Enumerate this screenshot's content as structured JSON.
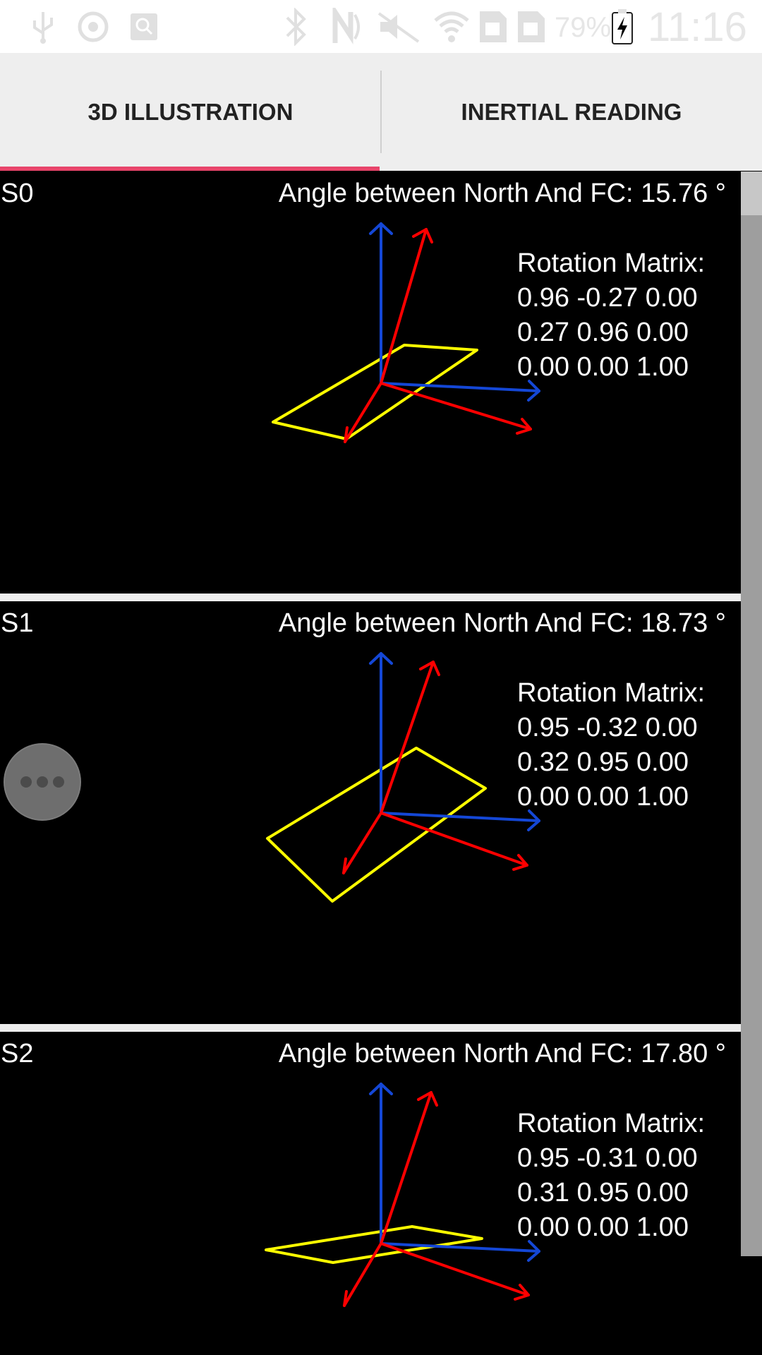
{
  "status_bar": {
    "icons": [
      "usb-icon",
      "sync-icon",
      "screenshot-icon",
      "bluetooth-icon",
      "nfc-icon",
      "mute-icon",
      "wifi-icon",
      "sim1-icon",
      "sim2-icon",
      "battery-charging-icon"
    ],
    "battery": "79%",
    "clock": "11:16"
  },
  "tabs": [
    {
      "label": "3D ILLUSTRATION",
      "selected": true
    },
    {
      "label": "INERTIAL READING",
      "selected": false
    }
  ],
  "colors": {
    "tab_indicator": "#e8456b",
    "z_axis": "#1447d6",
    "device_axes": "#ff0000",
    "device_plane": "#ffff00"
  },
  "sensors": [
    {
      "id": "S0",
      "angle_text": "Angle between North And FC: 15.76 °",
      "matrix_title": "Rotation Matrix:",
      "matrix_rows": [
        "0.96 -0.27 0.00",
        "0.27 0.96 0.00",
        "0.00 0.00 1.00"
      ]
    },
    {
      "id": "S1",
      "angle_text": "Angle between North And FC: 18.73 °",
      "matrix_title": "Rotation Matrix:",
      "matrix_rows": [
        "0.95 -0.32 0.00",
        "0.32 0.95 0.00",
        "0.00 0.00 1.00"
      ]
    },
    {
      "id": "S2",
      "angle_text": "Angle between North And FC: 17.80 °",
      "matrix_title": "Rotation Matrix:",
      "matrix_rows": [
        "0.95 -0.31 0.00",
        "0.31 0.95 0.00",
        "0.00 0.00 1.00"
      ]
    }
  ]
}
